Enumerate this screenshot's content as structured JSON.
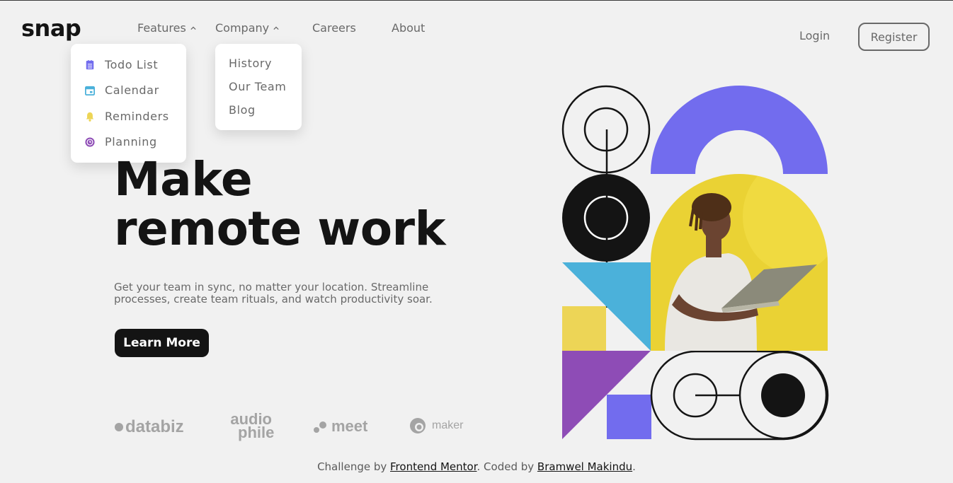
{
  "brand": {
    "logo": "snap"
  },
  "nav": {
    "features_label": "Features",
    "company_label": "Company",
    "careers_label": "Careers",
    "about_label": "About",
    "login_label": "Login",
    "register_label": "Register"
  },
  "features_menu": {
    "items": [
      {
        "label": "Todo List",
        "icon": "todo-icon",
        "color": "#726cee"
      },
      {
        "label": "Calendar",
        "icon": "calendar-icon",
        "color": "#4bb1da"
      },
      {
        "label": "Reminders",
        "icon": "bell-icon",
        "color": "#edd556"
      },
      {
        "label": "Planning",
        "icon": "clock-icon",
        "color": "#8e4cb6"
      }
    ]
  },
  "company_menu": {
    "items": [
      {
        "label": "History"
      },
      {
        "label": "Our Team"
      },
      {
        "label": "Blog"
      }
    ]
  },
  "hero": {
    "title_line1": "Make",
    "title_line2": "remote work",
    "subtitle": "Get your team in sync, no matter your location. Streamline processes, create team rituals, and watch productivity soar.",
    "cta_label": "Learn More"
  },
  "clients": {
    "databiz": "databiz",
    "audiophile_line1": "audio",
    "audiophile_line2": "phile",
    "meet": "meet",
    "maker": "maker"
  },
  "footer": {
    "prefix": "Challenge by ",
    "link1": "Frontend Mentor",
    "middle": ". Coded by ",
    "link2": "Bramwel Makindu",
    "suffix": "."
  },
  "colors": {
    "black": "#141414",
    "gray": "#696969",
    "violet": "#726cee",
    "yellow": "#edd556",
    "blue": "#4bb1da",
    "purple": "#8e4cb6"
  }
}
